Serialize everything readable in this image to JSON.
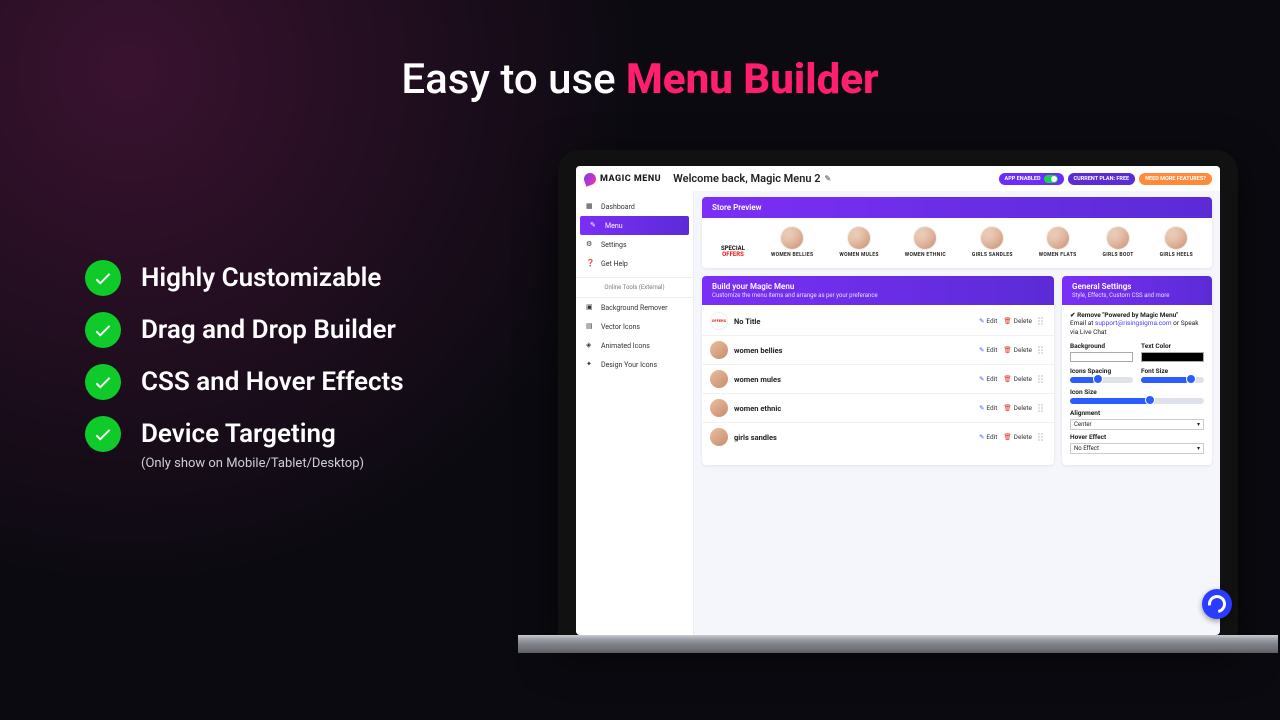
{
  "hero": {
    "part1": "Easy to use ",
    "part2": "Menu Builder"
  },
  "features": [
    "Highly Customizable",
    "Drag and Drop Builder",
    "CSS and Hover Effects",
    "Device Targeting"
  ],
  "features_subnote": "(Only show on Mobile/Tablet/Desktop)",
  "app": {
    "logo_text": "MAGIC MENU",
    "welcome": "Welcome back, Magic Menu 2",
    "header_pills": {
      "enabled": "APP ENABLED",
      "plan": "CURRENT PLAN: FREE",
      "upgrade": "NEED MORE FEATURES?"
    },
    "sidebar": {
      "items": [
        {
          "icon": "grid-icon",
          "label": "Dashboard"
        },
        {
          "icon": "pencil-icon",
          "label": "Menu"
        },
        {
          "icon": "gear-icon",
          "label": "Settings"
        },
        {
          "icon": "help-icon",
          "label": "Get Help"
        }
      ],
      "tools_header": "Online Tools (External)",
      "tools": [
        {
          "icon": "bg-remove-icon",
          "label": "Background Remover"
        },
        {
          "icon": "vector-icon",
          "label": "Vector Icons"
        },
        {
          "icon": "anim-icon",
          "label": "Animated Icons"
        },
        {
          "icon": "design-icon",
          "label": "Design Your Icons"
        }
      ]
    },
    "preview": {
      "title": "Store Preview",
      "items": [
        "SPECIAL OFFERS",
        "WOMEN BELLIES",
        "WOMEN MULES",
        "WOMEN ETHNIC",
        "GIRLS SANDLES",
        "WOMEN FLATS",
        "GIRLS BOOT",
        "GIRLS HEELS"
      ]
    },
    "build": {
      "title": "Build your Magic Menu",
      "subtitle": "Customize the menu items and arrange as per your preferance",
      "rows": [
        "No Title",
        "women bellies",
        "women mules",
        "women ethnic",
        "girls sandles"
      ],
      "edit_label": "Edit",
      "delete_label": "Delete"
    },
    "settings": {
      "title": "General Settings",
      "subtitle": "Style, Effects, Custom CSS and more",
      "remove_text": "Remove \"Powered by Magic Menu\"",
      "note_prefix": "Email at ",
      "note_email": "support@risingsigma.com",
      "note_suffix": " or Speak via Live Chat",
      "labels": {
        "background": "Background",
        "text_color": "Text Color",
        "icons_spacing": "Icons Spacing",
        "font_size": "Font Size",
        "icon_size": "Icon Size",
        "alignment": "Alignment",
        "hover_effect": "Hover Effect"
      },
      "alignment_value": "Center",
      "hover_value": "No Effect",
      "sliders": {
        "spacing": 40,
        "font_size": 75,
        "icon_size": 60
      }
    }
  }
}
